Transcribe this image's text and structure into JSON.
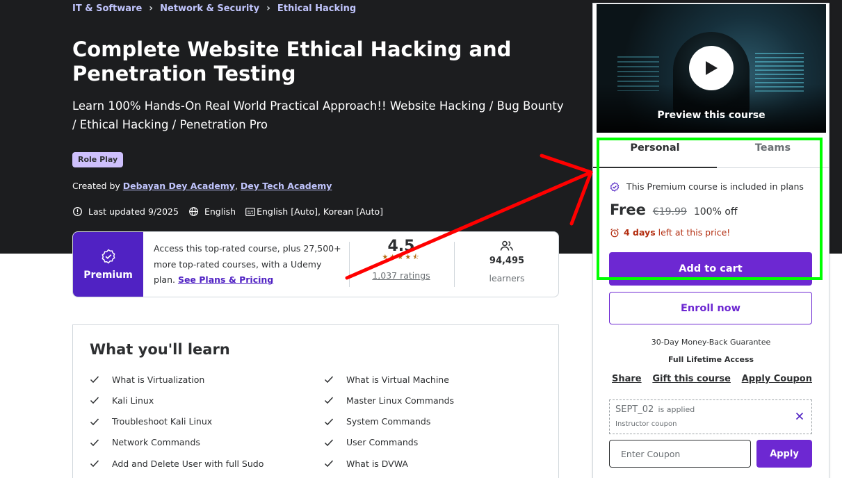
{
  "breadcrumbs": [
    "IT & Software",
    "Network & Security",
    "Ethical Hacking"
  ],
  "course": {
    "title": "Complete Website Ethical Hacking and Penetration Testing",
    "subtitle": "Learn 100% Hands-On Real World Practical Approach!! Website Hacking / Bug Bounty / Ethical Hacking / Penetration Pro",
    "badge": "Role Play",
    "created_by_label": "Created by",
    "authors": [
      "Debayan Dey Academy",
      "Dey Tech Academy"
    ],
    "author_separator": ",",
    "last_updated": "Last updated 9/2025",
    "language": "English",
    "captions": "English [Auto], Korean [Auto]"
  },
  "premium": {
    "label": "Premium",
    "text": "Access this top-rated course, plus 27,500+ more top-rated courses, with a Udemy plan.",
    "link": "See Plans & Pricing",
    "rating": 4.5,
    "rating_text": "4.5",
    "stars": "★★★★⯪",
    "ratings_count": "1,037 ratings",
    "learners_count": "94,495",
    "learners_label": "learners"
  },
  "learn": {
    "heading": "What you'll learn",
    "items": [
      "What is Virtualization",
      "What is Virtual Machine",
      "Kali Linux",
      "Master Linux Commands",
      "Troubleshoot Kali Linux",
      "System Commands",
      "Network Commands",
      "User Commands",
      "Add and Delete User with full Sudo",
      "What is DVWA"
    ]
  },
  "sidebar": {
    "preview_label": "Preview this course",
    "tabs": [
      "Personal",
      "Teams"
    ],
    "plans_text": "This Premium course is included in plans",
    "price": "Free",
    "original_price": "€19.99",
    "discount": "100% off",
    "timer_days": "4 days",
    "timer_text": "left at this price!",
    "add_to_cart": "Add to cart",
    "enroll_now": "Enroll now",
    "guarantee": "30-Day Money-Back Guarantee",
    "lifetime": "Full Lifetime Access",
    "links": [
      "Share",
      "Gift this course",
      "Apply Coupon"
    ],
    "coupon_code": "SEPT_02",
    "coupon_applied": "is applied",
    "coupon_type": "Instructor coupon",
    "coupon_placeholder": "Enter Coupon",
    "apply": "Apply"
  },
  "colors": {
    "hero_bg": "#1c1d1f",
    "brand_purple": "#6d28d2",
    "premium_purple": "#5022c3",
    "link_lavender": "#c0c4fc",
    "warning_red": "#b32d0f",
    "annotation_arrow": "#ff0000",
    "annotation_box": "#00ff00"
  },
  "icons": [
    "chevron-right-icon",
    "alert-clock-icon",
    "globe-icon",
    "captions-icon",
    "premium-badge-icon",
    "learners-icon",
    "check-icon",
    "play-icon",
    "verified-icon",
    "alarm-icon",
    "close-icon"
  ]
}
